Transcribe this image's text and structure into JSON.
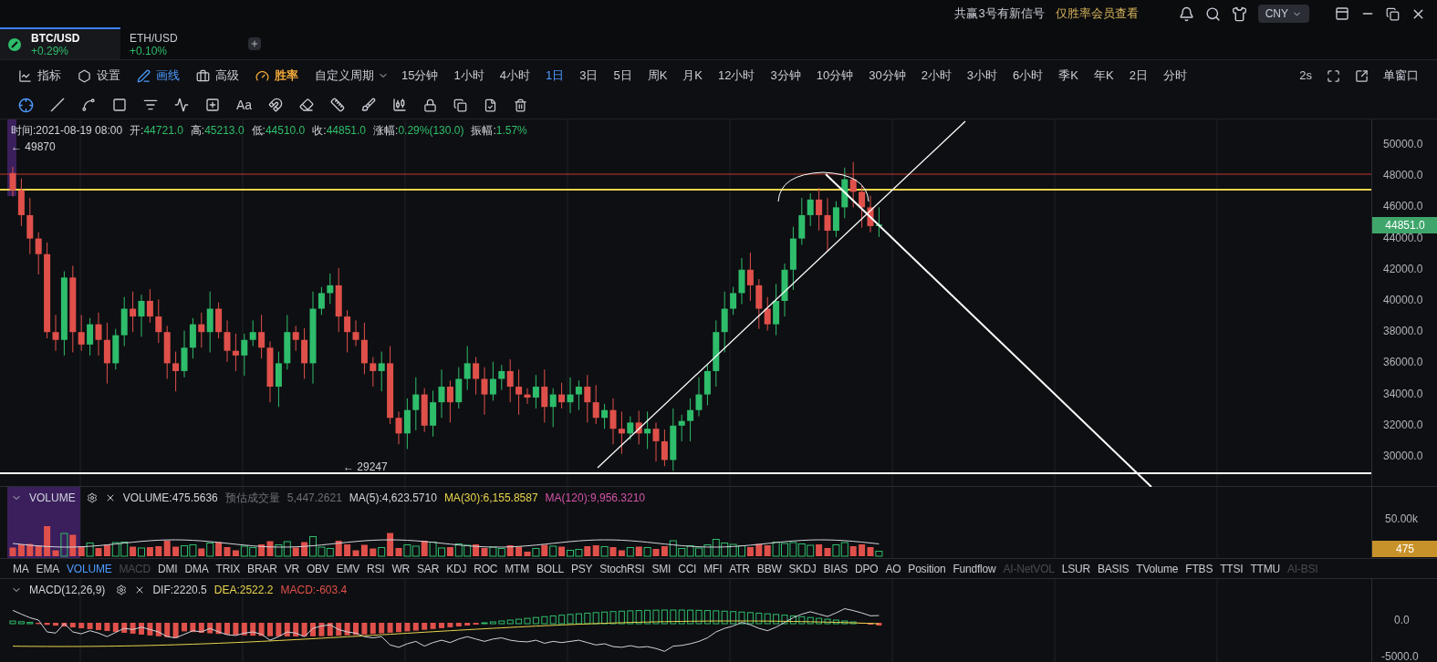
{
  "top_bar": {
    "notice": "共赢3号有新信号",
    "link": "仅胜率会员查看",
    "currency": "CNY"
  },
  "tabs": [
    {
      "symbol": "BTC/USD",
      "change": "+0.29%",
      "selected": true
    },
    {
      "symbol": "ETH/USD",
      "change": "+0.10%",
      "selected": false
    }
  ],
  "toolbar": {
    "tools": [
      {
        "label": "指标",
        "kind": "tool",
        "active": false
      },
      {
        "label": "设置",
        "kind": "tool",
        "active": false
      },
      {
        "label": "画线",
        "kind": "tool",
        "active": true
      },
      {
        "label": "高级",
        "kind": "tool",
        "active": false
      },
      {
        "label": "胜率",
        "kind": "premium",
        "active": false
      }
    ],
    "custom_period": "自定义周期",
    "periods": [
      {
        "label": "15分钟",
        "selected": false
      },
      {
        "label": "1小时",
        "selected": false
      },
      {
        "label": "4小时",
        "selected": false
      },
      {
        "label": "1日",
        "selected": true
      },
      {
        "label": "3日",
        "selected": false
      },
      {
        "label": "5日",
        "selected": false
      },
      {
        "label": "周K",
        "selected": false
      },
      {
        "label": "月K",
        "selected": false
      },
      {
        "label": "12小时",
        "selected": false
      },
      {
        "label": "3分钟",
        "selected": false
      },
      {
        "label": "10分钟",
        "selected": false
      },
      {
        "label": "30分钟",
        "selected": false
      },
      {
        "label": "2小时",
        "selected": false
      },
      {
        "label": "3小时",
        "selected": false
      },
      {
        "label": "6小时",
        "selected": false
      },
      {
        "label": "季K",
        "selected": false
      },
      {
        "label": "年K",
        "selected": false
      },
      {
        "label": "2日",
        "selected": false
      },
      {
        "label": "分时",
        "selected": false
      }
    ],
    "refresh": "2s",
    "window_mode": "单窗口"
  },
  "drawing_tools": {
    "text_tool": "Aa"
  },
  "ohlc": [
    {
      "label": "时间:",
      "value": "2021-08-19 08:00",
      "kind": "time"
    },
    {
      "label": "开:",
      "value": "44721.0",
      "kind": "price"
    },
    {
      "label": "高:",
      "value": "45213.0",
      "kind": "price"
    },
    {
      "label": "低:",
      "value": "44510.0",
      "kind": "price"
    },
    {
      "label": "收:",
      "value": "44851.0",
      "kind": "price"
    },
    {
      "label": "涨幅:",
      "value": "0.29%(130.0)",
      "kind": "price"
    },
    {
      "label": "振幅:",
      "value": "1.57%",
      "kind": "price"
    }
  ],
  "markers": {
    "high": "← 49870",
    "low": "← 29247"
  },
  "price_axis": {
    "ticks": [
      "50000.0",
      "48000.0",
      "46000.0",
      "44000.0",
      "42000.0",
      "40000.0",
      "38000.0",
      "36000.0",
      "34000.0",
      "32000.0",
      "30000.0"
    ],
    "last_price": "44851.0"
  },
  "volume_pane": {
    "title": "VOLUME",
    "readings": [
      {
        "text": "VOLUME:475.5636",
        "color": "#d1d4dc"
      },
      {
        "text": "预估成交量",
        "color": "#6b6f78"
      },
      {
        "text": "5,447.2621",
        "color": "#6b6f78"
      },
      {
        "text": "MA(5):4,623.5710",
        "color": "#d1d4dc"
      },
      {
        "text": "MA(30):6,155.8587",
        "color": "#e8d44d"
      },
      {
        "text": "MA(120):9,956.3210",
        "color": "#d454a8"
      }
    ],
    "axis": "50.00k",
    "last_volume": "475"
  },
  "indicators": [
    {
      "label": "MA",
      "selected": false,
      "disabled": false
    },
    {
      "label": "EMA",
      "selected": false,
      "disabled": false
    },
    {
      "label": "VOLUME",
      "selected": true,
      "disabled": false
    },
    {
      "label": "MACD",
      "selected": false,
      "disabled": true
    },
    {
      "label": "DMI",
      "selected": false,
      "disabled": false
    },
    {
      "label": "DMA",
      "selected": false,
      "disabled": false
    },
    {
      "label": "TRIX",
      "selected": false,
      "disabled": false
    },
    {
      "label": "BRAR",
      "selected": false,
      "disabled": false
    },
    {
      "label": "VR",
      "selected": false,
      "disabled": false
    },
    {
      "label": "OBV",
      "selected": false,
      "disabled": false
    },
    {
      "label": "EMV",
      "selected": false,
      "disabled": false
    },
    {
      "label": "RSI",
      "selected": false,
      "disabled": false
    },
    {
      "label": "WR",
      "selected": false,
      "disabled": false
    },
    {
      "label": "SAR",
      "selected": false,
      "disabled": false
    },
    {
      "label": "KDJ",
      "selected": false,
      "disabled": false
    },
    {
      "label": "ROC",
      "selected": false,
      "disabled": false
    },
    {
      "label": "MTM",
      "selected": false,
      "disabled": false
    },
    {
      "label": "BOLL",
      "selected": false,
      "disabled": false
    },
    {
      "label": "PSY",
      "selected": false,
      "disabled": false
    },
    {
      "label": "StochRSI",
      "selected": false,
      "disabled": false
    },
    {
      "label": "SMI",
      "selected": false,
      "disabled": false
    },
    {
      "label": "CCI",
      "selected": false,
      "disabled": false
    },
    {
      "label": "MFI",
      "selected": false,
      "disabled": false
    },
    {
      "label": "ATR",
      "selected": false,
      "disabled": false
    },
    {
      "label": "BBW",
      "selected": false,
      "disabled": false
    },
    {
      "label": "SKDJ",
      "selected": false,
      "disabled": false
    },
    {
      "label": "BIAS",
      "selected": false,
      "disabled": false
    },
    {
      "label": "DPO",
      "selected": false,
      "disabled": false
    },
    {
      "label": "AO",
      "selected": false,
      "disabled": false
    },
    {
      "label": "Position",
      "selected": false,
      "disabled": false
    },
    {
      "label": "Fundflow",
      "selected": false,
      "disabled": false
    },
    {
      "label": "AI-NetVOL",
      "selected": false,
      "disabled": true
    },
    {
      "label": "LSUR",
      "selected": false,
      "disabled": false
    },
    {
      "label": "BASIS",
      "selected": false,
      "disabled": false
    },
    {
      "label": "TVolume",
      "selected": false,
      "disabled": false
    },
    {
      "label": "FTBS",
      "selected": false,
      "disabled": false
    },
    {
      "label": "TTSI",
      "selected": false,
      "disabled": false
    },
    {
      "label": "TTMU",
      "selected": false,
      "disabled": false
    },
    {
      "label": "AI-BSI",
      "selected": false,
      "disabled": true
    }
  ],
  "macd_pane": {
    "title": "MACD(12,26,9)",
    "readings": [
      {
        "text": "DIF:2220.5",
        "color": "#d1d4dc"
      },
      {
        "text": "DEA:2522.2",
        "color": "#e8d44d"
      },
      {
        "text": "MACD:-603.4",
        "color": "#e0504a"
      }
    ],
    "axis": [
      "0.0",
      "-5000.0"
    ]
  }
}
